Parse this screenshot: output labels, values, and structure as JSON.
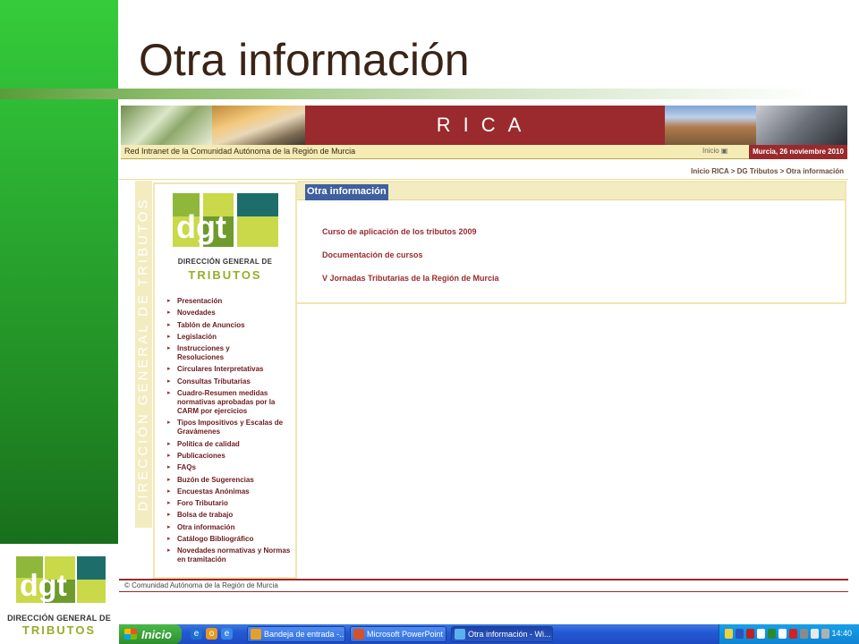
{
  "slide": {
    "title": "Otra información",
    "corner_logo": {
      "caption_line1": "DIRECCIÓN GENERAL DE",
      "caption_line2": "TRIBUTOS"
    }
  },
  "banner": {
    "brand": "RICA",
    "intranet_label": "Red Intranet de la Comunidad Autónoma de la Región de Murcia",
    "inicio_link": "Inicio",
    "date": "Murcia, 26 noviembre 2010"
  },
  "breadcrumb": "Inicio RICA > DG Tributos > Otra información",
  "side_band_text": "DIRECCIÓN GENERAL DE TRIBUTOS",
  "nav": {
    "logo_caption1": "DIRECCIÓN GENERAL DE",
    "logo_caption2": "TRIBUTOS",
    "items": [
      "Presentación",
      "Novedades",
      "Tablón de Anuncios",
      "Legislación",
      "Instrucciones y\nResoluciones",
      "Circulares Interpretativas",
      "Consultas Tributarias",
      "Cuadro-Resumen medidas normativas aprobadas por la CARM por ejercicios",
      "Tipos Impositivos y Escalas de Gravámenes",
      "Política de calidad",
      "Publicaciones",
      "FAQs",
      "Buzón de Sugerencias",
      "Encuestas Anónimas",
      "Foro Tributario",
      "Bolsa de trabajo",
      "Otra información",
      "Catálogo Bibliográfico",
      "Novedades normativas y Normas en tramitación"
    ]
  },
  "content": {
    "title": "Otra información",
    "links": [
      "Curso de aplicación de los tributos 2009",
      "Documentación de cursos",
      "V Jornadas Tributarias de la Región de Murcia"
    ]
  },
  "footer": "© Comunidad Autónoma de la Región de Murcia",
  "taskbar": {
    "start": "Inicio",
    "tasks": [
      {
        "label": "Bandeja de entrada -...",
        "icon": "mail-icon"
      },
      {
        "label": "Microsoft PowerPoint ...",
        "icon": "powerpoint-icon"
      },
      {
        "label": "Otra información - Wi...",
        "icon": "internet-explorer-icon"
      }
    ],
    "clock": "14:40"
  },
  "colors": {
    "green_band": "#2cb233",
    "maroon": "#9a2a2d",
    "cream": "#f3ecc0",
    "link": "#9a2a2d",
    "title_tab": "#3f5f9e",
    "taskbar": "#2459d4"
  }
}
